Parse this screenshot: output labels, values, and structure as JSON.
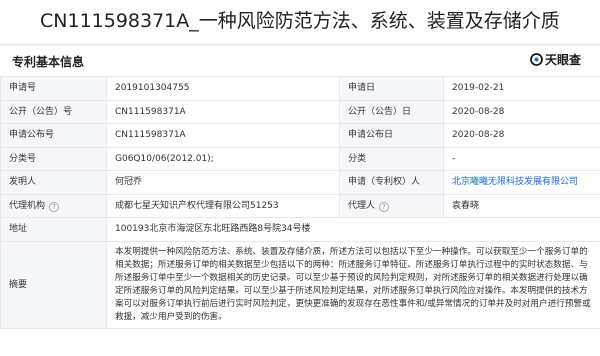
{
  "page": {
    "title": "CN111598371A_一种风险防范方法、系统、装置及存储介质",
    "section_title": "专利基本信息",
    "logo_text": "天眼查",
    "accent_color": "#1e6ad8"
  },
  "fields": {
    "application_no": {
      "label": "申请号",
      "value": "2019101304755"
    },
    "application_date": {
      "label": "申请日",
      "value": "2019-02-21"
    },
    "publication_no": {
      "label": "公开（公告）号",
      "value": "CN111598371A"
    },
    "publication_date": {
      "label": "公开（公告）日",
      "value": "2020-08-28"
    },
    "app_publication_no": {
      "label": "申请公布号",
      "value": "CN111598371A"
    },
    "app_publication_date": {
      "label": "申请公布日",
      "value": "2020-08-28"
    },
    "classification": {
      "label": "分类号",
      "value": "G06Q10/06(2012.01);"
    },
    "category": {
      "label": "分类",
      "value": "-"
    },
    "inventor": {
      "label": "发明人",
      "value": "何冠乔"
    },
    "applicant": {
      "label": "申请（专利权）人",
      "value": "北京曦曦无限科技发展有限公司"
    },
    "agency": {
      "label": "代理机构",
      "value": "成都七星天知识产权代理有限公司51253"
    },
    "agent": {
      "label": "代理人",
      "value": "袁春晓"
    },
    "address": {
      "label": "地址",
      "value": "100193北京市海淀区东北旺路西路8号院34号楼"
    },
    "abstract": {
      "label": "摘要",
      "value": "本发明提供一种风险防范方法、系统、装置及存储介质，所述方法可以包括以下至少一种操作。可以获取至少一个服务订单的相关数据；所述服务订单的相关数据至少包括以下的两种：所述服务订单特征、所述服务订单执行过程中的实时状态数据、与所述服务订单中至少一个数据相关的历史记录。可以至少基于预设的风险判定规则，对所述服务订单的相关数据进行处理以确定所述服务订单的风险判定结果。可以至少基于所述风险判定结果，对所述服务订单执行风险应对操作。本发明提供的技术方案可以对服务订单执行前后进行实时风险判定，更快更准确的发现存在恶性事件和/或异常情况的订单并及时对用户进行预警或救援，减少用户受到的伤害。"
    }
  }
}
